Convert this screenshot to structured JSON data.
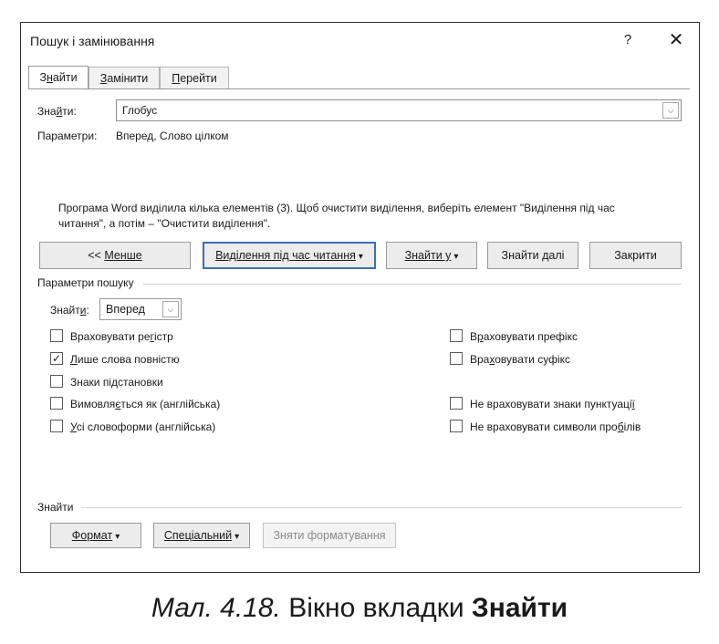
{
  "dialog": {
    "title": "Пошук і замінювання",
    "help_label": "?",
    "close_label": "✕"
  },
  "tabs": [
    {
      "label_pre": "З",
      "label_u": "н",
      "label_post": "айти",
      "active": true
    },
    {
      "label_pre": "",
      "label_u": "З",
      "label_post": "амінити",
      "active": false
    },
    {
      "label_pre": "",
      "label_u": "П",
      "label_post": "ерейти",
      "active": false
    }
  ],
  "find": {
    "label_pre": "Зна",
    "label_u": "й",
    "label_post": "ти:",
    "value": "Глобус",
    "dropdown_icon": "chevron-down-icon"
  },
  "parameters": {
    "label": "Параметри:",
    "value": "Вперед, Слово цілком"
  },
  "message": "Програма Word виділила кілька елементів (3). Щоб очистити виділення, виберіть елемент \"Виділення під час читання\", а потім – \"Очистити виділення\".",
  "buttons": {
    "less_pre": "<< ",
    "less_u": "М",
    "less_post": "енше",
    "reading_pre": "",
    "reading_u": "В",
    "reading_post": "иділення під час читання",
    "find_in_pre": "",
    "find_in_u": "З",
    "find_in_post": "найти у",
    "find_next_pre": "Знайти ",
    "find_next_u": "д",
    "find_next_post": "алі",
    "close": "Закрити",
    "arrow": "▾"
  },
  "search_options": {
    "title": "Параметри пошуку",
    "direction_label_pre": "Знайт",
    "direction_label_u": "и",
    "direction_label_post": ":",
    "direction_value": "Вперед",
    "left": [
      {
        "pre": "Враховувати ре",
        "u": "г",
        "post": "істр",
        "checked": false
      },
      {
        "pre": "",
        "u": "Л",
        "post": "ише слова повністю",
        "checked": true
      },
      {
        "pre": "Знаки пі",
        "u": "д",
        "post": "становки",
        "checked": false
      },
      {
        "pre": "Вимовля",
        "u": "є",
        "post": "ться як (англійська)",
        "checked": false
      },
      {
        "pre": "",
        "u": "У",
        "post": "сі словоформи (англійська)",
        "checked": false
      }
    ],
    "right": [
      {
        "pre": "В",
        "u": "р",
        "post": "аховувати префікс",
        "checked": false
      },
      {
        "pre": "Вра",
        "u": "х",
        "post": "овувати суфікс",
        "checked": false
      },
      {
        "pre": "Не враховувати знаки пунктуаці",
        "u": "ї",
        "post": "",
        "checked": false
      },
      {
        "pre": "Не враховувати символи про",
        "u": "б",
        "post": "ілів",
        "checked": false
      }
    ],
    "check_mark": "✓"
  },
  "find_section": {
    "title": "Знайти",
    "format_pre": "",
    "format_u": "Ф",
    "format_post": "ормат",
    "special_pre": "",
    "special_u": "С",
    "special_post": "пеціальний",
    "remove_formatting": "Зняти форматування"
  },
  "caption": {
    "italic": "Мал. 4.18.",
    "normal": " Вікно вкладки ",
    "bold": "Знайти"
  }
}
